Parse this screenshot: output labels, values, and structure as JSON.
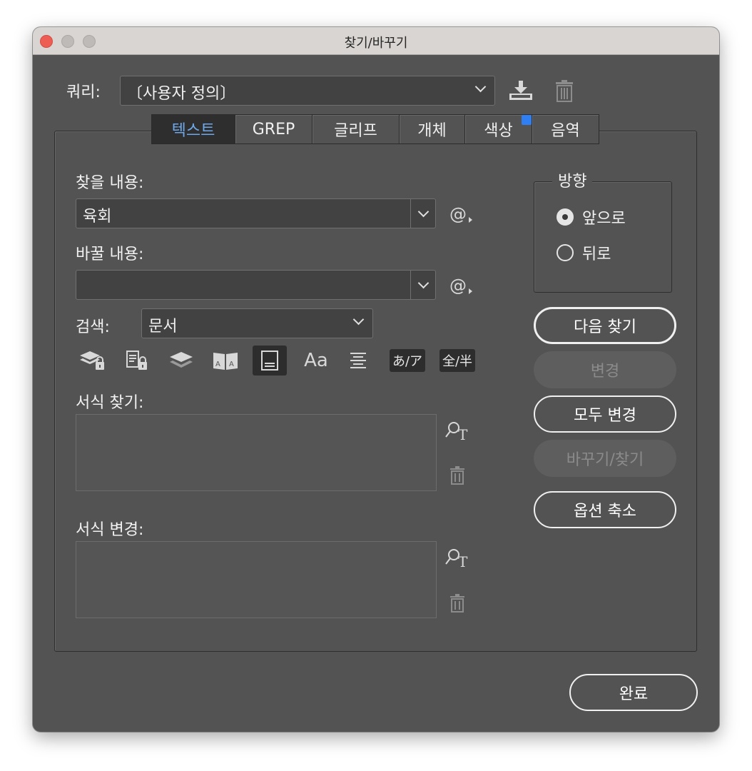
{
  "window": {
    "title": "찾기/바꾸기"
  },
  "query": {
    "label": "쿼리:",
    "value": "〔사용자 정의〕"
  },
  "tabs": [
    {
      "label": "텍스트",
      "active": true
    },
    {
      "label": "GREP"
    },
    {
      "label": "글리프"
    },
    {
      "label": "개체"
    },
    {
      "label": "색상",
      "badge": true
    },
    {
      "label": "음역"
    }
  ],
  "find": {
    "label": "찾을 내용:",
    "value": "육회",
    "special_char": "@"
  },
  "replace": {
    "label": "바꿀 내용:",
    "value": "",
    "special_char": "@"
  },
  "search": {
    "label": "검색:",
    "value": "문서"
  },
  "search_options": {
    "icons": [
      "include-locked-layers-icon",
      "include-locked-stories-icon",
      "include-hidden-layers-icon",
      "include-master-pages-icon",
      "include-footnotes-icon",
      "case-sensitive-icon",
      "whole-word-icon"
    ],
    "case_label": "Aa",
    "kana_label": "あ/ア",
    "width_label": "全/半"
  },
  "find_format": {
    "label": "서식 찾기:"
  },
  "change_format": {
    "label": "서식 변경:"
  },
  "direction": {
    "title": "방향",
    "options": [
      {
        "label": "앞으로",
        "selected": true
      },
      {
        "label": "뒤로",
        "selected": false
      }
    ]
  },
  "buttons": {
    "find_next": "다음 찾기",
    "change": "변경",
    "change_all": "모두 변경",
    "change_find": "바꾸기/찾기",
    "fewer_options": "옵션 축소",
    "done": "완료"
  },
  "colors": {
    "accent_tab": "#6ea8ea",
    "badge": "#2f7ef2",
    "window_bg": "#535353"
  }
}
